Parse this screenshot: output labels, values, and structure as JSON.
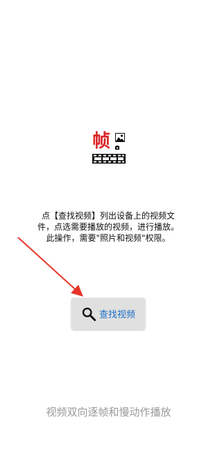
{
  "logo": {
    "char": "帧",
    "accent_color": "#d9252a",
    "photo_icon": "image-icon",
    "camera_icon": "camera-icon",
    "film_icon": "film-strip-icon"
  },
  "instructions": {
    "line1": "点【查找视频】列出设备上的视频文件，点选需要播放的视频，进行播放。",
    "line2": "此操作，需要\"照片和视频\"权限。"
  },
  "find_button": {
    "icon": "search-icon",
    "label": "查找视频",
    "label_color": "#1b6fc6"
  },
  "pointer_arrow": {
    "icon": "arrow-icon",
    "color": "#e8342a"
  },
  "tagline": "视频双向逐帧和慢动作播放"
}
